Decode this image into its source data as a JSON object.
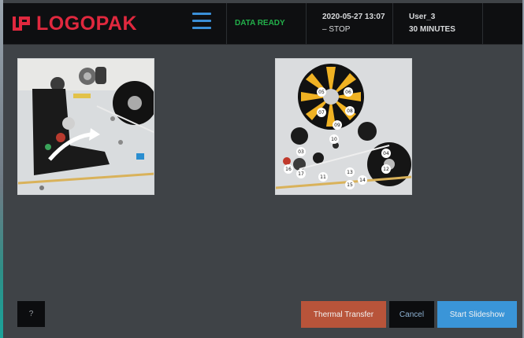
{
  "brand": {
    "name": "LOGOPAK",
    "accent": "#e0283e"
  },
  "header": {
    "status": {
      "text": "DATA READY",
      "color": "#22b04a"
    },
    "datetime": "2020-05-27 13:07",
    "state": "– STOP",
    "user": "User_3",
    "session": "30 MINUTES"
  },
  "menu": {
    "icon": "hamburger-menu-icon"
  },
  "images": {
    "left": {
      "description": ""
    },
    "right": {
      "labels": [
        "05",
        "06",
        "07",
        "08",
        "09",
        "10",
        "04",
        "12",
        "13",
        "14",
        "15",
        "03",
        "16",
        "17",
        "11"
      ]
    }
  },
  "footer": {
    "help_label": "?",
    "thermal_label": "Thermal Transfer",
    "cancel_label": "Cancel",
    "slideshow_label": "Start Slideshow",
    "thermal_color": "#b8543a",
    "slideshow_color": "#3a95d8"
  }
}
